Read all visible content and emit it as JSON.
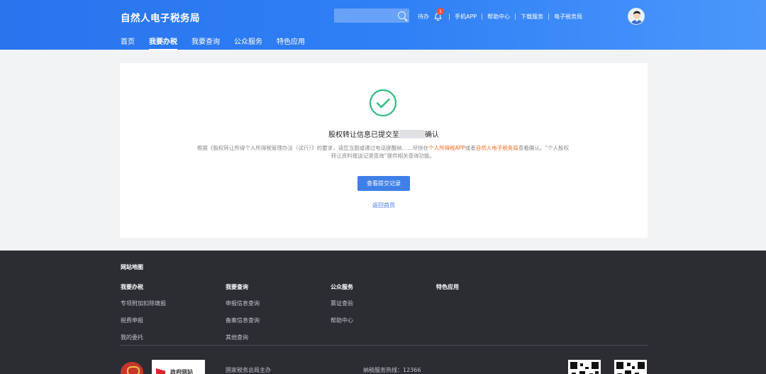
{
  "header": {
    "brand": "自然人电子税务局",
    "search_placeholder": "",
    "links": [
      "待办",
      "手机APP",
      "帮助中心",
      "下载服务",
      "电子税务局"
    ],
    "notification_count": "1",
    "accent": "#2f7ff5"
  },
  "nav": {
    "tabs": [
      {
        "label": "首页",
        "active": false
      },
      {
        "label": "我要办税",
        "active": true
      },
      {
        "label": "我要查询",
        "active": false
      },
      {
        "label": "公众服务",
        "active": false
      },
      {
        "label": "特色应用",
        "active": false
      }
    ]
  },
  "result": {
    "icon": "check-circle-icon",
    "title_prefix": "股权转让信息已提交至",
    "title_suffix": "确认",
    "desc_part1": "根据《股权转让所得个人所得税管理办法（试行）》的要求，请您当面或通过电话提醒纳",
    "desc_masked": "……",
    "desc_part2": "尽快在",
    "desc_link1": "个人所得税APP",
    "desc_part3": "或者",
    "desc_link2": "自然人电子税务局",
    "desc_part4": "查看确认。“个人股权转让资料报送记录查询”提供相关查询功能。",
    "primary_button": "查看提交记录",
    "back_link": "返回首页",
    "highlight_color": "#f36b1c"
  },
  "footer": {
    "sitemap_title": "网站地图",
    "columns": [
      {
        "heading": "我要办税",
        "items": [
          "专项附加扣除填报",
          "税费申报",
          "我的委托"
        ]
      },
      {
        "heading": "我要查询",
        "items": [
          "申报信息查询",
          "备案信息查询",
          "其他查询"
        ]
      },
      {
        "heading": "公众服务",
        "items": [
          "票证查验",
          "帮助中心"
        ]
      },
      {
        "heading": "特色应用",
        "items": []
      }
    ],
    "logo_text": "政府网站",
    "host": "国家税务总局主办",
    "hotline": "纳税服务热线：12366"
  }
}
